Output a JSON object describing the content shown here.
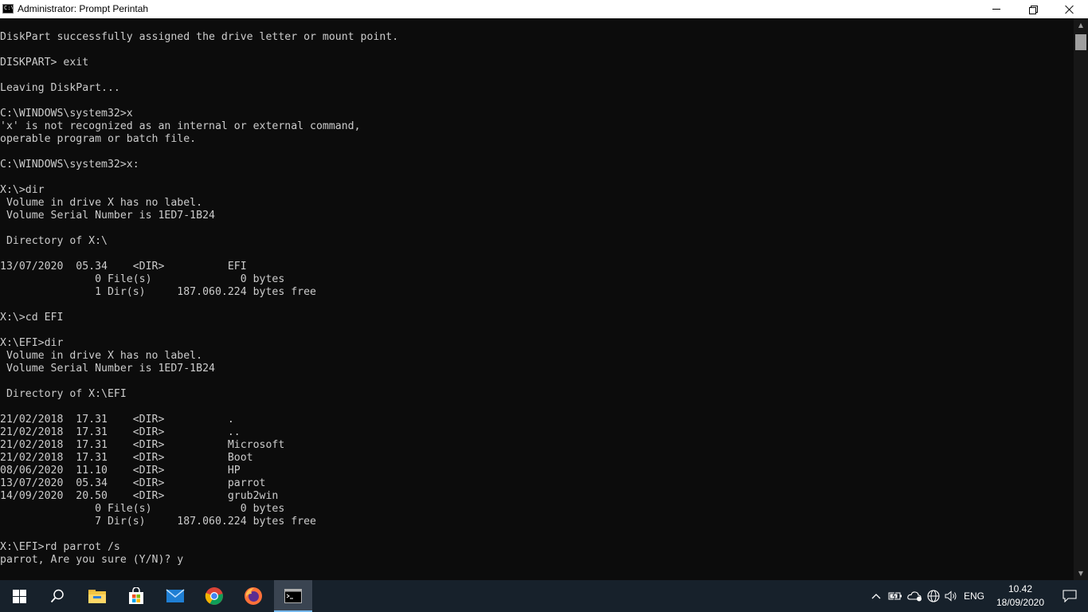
{
  "window": {
    "title": "Administrator: Prompt Perintah",
    "icon_text": "C:\\"
  },
  "console": {
    "lines": [
      "DiskPart successfully assigned the drive letter or mount point.",
      "",
      "DISKPART> exit",
      "",
      "Leaving DiskPart...",
      "",
      "C:\\WINDOWS\\system32>x",
      "'x' is not recognized as an internal or external command,",
      "operable program or batch file.",
      "",
      "C:\\WINDOWS\\system32>x:",
      "",
      "X:\\>dir",
      " Volume in drive X has no label.",
      " Volume Serial Number is 1ED7-1B24",
      "",
      " Directory of X:\\",
      "",
      "13/07/2020  05.34    <DIR>          EFI",
      "               0 File(s)              0 bytes",
      "               1 Dir(s)     187.060.224 bytes free",
      "",
      "X:\\>cd EFI",
      "",
      "X:\\EFI>dir",
      " Volume in drive X has no label.",
      " Volume Serial Number is 1ED7-1B24",
      "",
      " Directory of X:\\EFI",
      "",
      "21/02/2018  17.31    <DIR>          .",
      "21/02/2018  17.31    <DIR>          ..",
      "21/02/2018  17.31    <DIR>          Microsoft",
      "21/02/2018  17.31    <DIR>          Boot",
      "08/06/2020  11.10    <DIR>          HP",
      "13/07/2020  05.34    <DIR>          parrot",
      "14/09/2020  20.50    <DIR>          grub2win",
      "               0 File(s)              0 bytes",
      "               7 Dir(s)     187.060.224 bytes free",
      "",
      "X:\\EFI>rd parrot /s",
      "parrot, Are you sure (Y/N)? y"
    ]
  },
  "taskbar": {
    "language": "ENG",
    "time": "10.42",
    "date": "18/09/2020",
    "pinned": [
      "start-icon",
      "search-icon",
      "file-explorer-icon",
      "store-icon",
      "mail-icon",
      "chrome-icon",
      "firefox-icon",
      "command-prompt-icon"
    ]
  },
  "colors": {
    "console_bg": "#0c0c0c",
    "console_fg": "#cccccc",
    "taskbar_bg": "#17212b",
    "titlebar_bg": "#ffffff"
  }
}
